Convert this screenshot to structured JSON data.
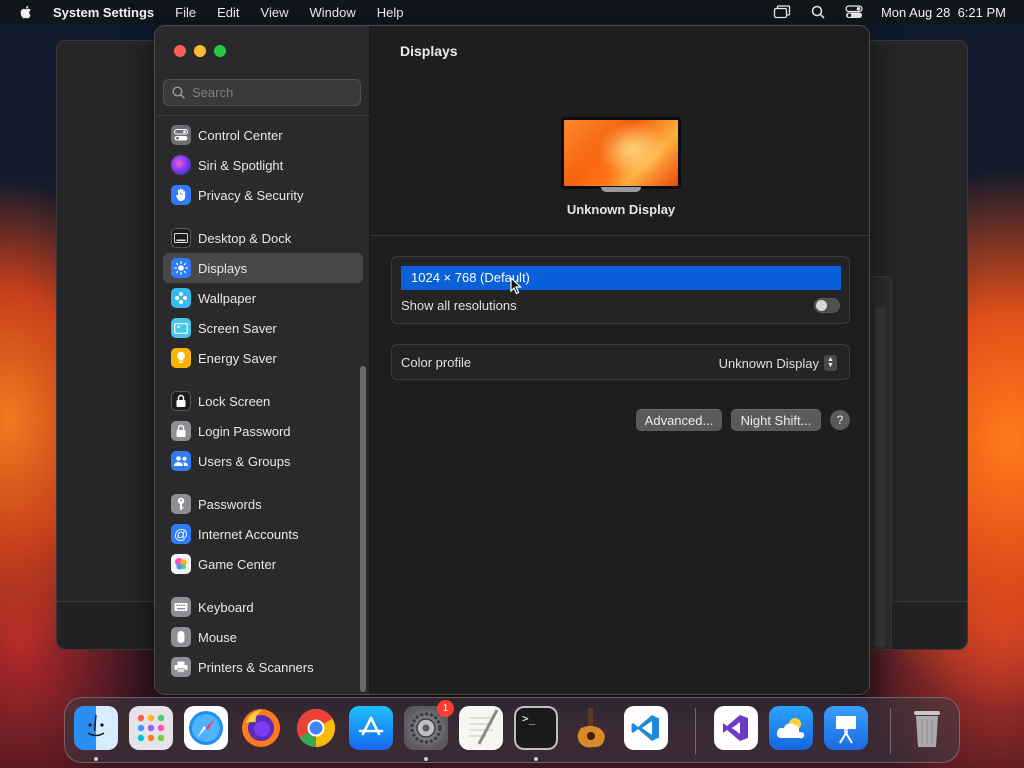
{
  "menubar": {
    "app_name": "System Settings",
    "menus": [
      "File",
      "Edit",
      "View",
      "Window",
      "Help"
    ],
    "clock": "Mon Aug 28  6:21 PM"
  },
  "sidebar": {
    "search_placeholder": "Search",
    "groups": [
      [
        {
          "label": "Control Center",
          "icon": "control-center-icon",
          "color": "#6e6e73"
        },
        {
          "label": "Siri & Spotlight",
          "icon": "siri-icon",
          "color": "#7a3cf0"
        },
        {
          "label": "Privacy & Security",
          "icon": "hand-icon",
          "color": "#2f7cf6"
        }
      ],
      [
        {
          "label": "Desktop & Dock",
          "icon": "dock-icon",
          "color": "#1c1c1e"
        },
        {
          "label": "Displays",
          "icon": "sun-icon",
          "color": "#2f7cf6",
          "selected": true
        },
        {
          "label": "Wallpaper",
          "icon": "wallpaper-icon",
          "color": "#3ab8f0"
        },
        {
          "label": "Screen Saver",
          "icon": "screen-saver-icon",
          "color": "#46c6e8"
        },
        {
          "label": "Energy Saver",
          "icon": "battery-icon",
          "color": "#f5b400"
        }
      ],
      [
        {
          "label": "Lock Screen",
          "icon": "lock-icon",
          "color": "#1c1c1e"
        },
        {
          "label": "Login Password",
          "icon": "login-lock-icon",
          "color": "#8e8e93"
        },
        {
          "label": "Users & Groups",
          "icon": "users-icon",
          "color": "#2f7cf6"
        }
      ],
      [
        {
          "label": "Passwords",
          "icon": "key-icon",
          "color": "#8e8e93"
        },
        {
          "label": "Internet Accounts",
          "icon": "at-icon",
          "color": "#2f7cf6"
        },
        {
          "label": "Game Center",
          "icon": "game-center-icon",
          "color": "#f2f2f7"
        }
      ],
      [
        {
          "label": "Keyboard",
          "icon": "keyboard-icon",
          "color": "#8e8e93"
        },
        {
          "label": "Mouse",
          "icon": "mouse-icon",
          "color": "#8e8e93"
        },
        {
          "label": "Printers & Scanners",
          "icon": "printer-icon",
          "color": "#8e8e93"
        }
      ]
    ]
  },
  "content": {
    "title": "Displays",
    "display_name": "Unknown Display",
    "resolution_selected": "1024 × 768 (Default)",
    "show_all_label": "Show all resolutions",
    "show_all_on": false,
    "color_profile_label": "Color profile",
    "color_profile_value": "Unknown Display",
    "advanced_button": "Advanced...",
    "night_shift_button": "Night Shift...",
    "help_button": "?"
  },
  "dock": {
    "items": [
      "Finder",
      "Launchpad",
      "Safari",
      "Firefox",
      "Chrome",
      "App Store",
      "System Settings",
      "TextEdit",
      "Terminal",
      "GarageBand",
      "Visual Studio Code",
      "Visual Studio",
      "Weather",
      "Keynote",
      "Trash"
    ],
    "system_settings_badge": "1"
  },
  "colors": {
    "accent": "#0a60d8",
    "window_bg": "#1e1e1e",
    "sidebar_bg": "#2a2a2c"
  }
}
